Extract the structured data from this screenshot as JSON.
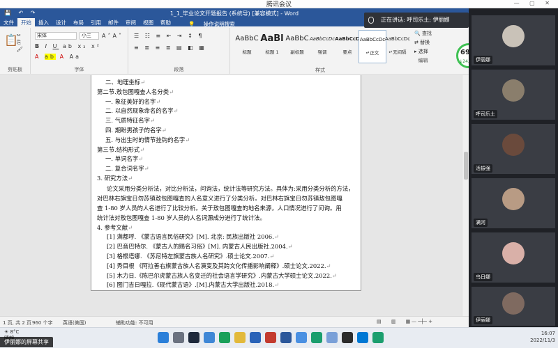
{
  "meeting": {
    "title": "腾讯会议",
    "speaking_label": "正在讲话: 呼司乐土; 伊丽娜"
  },
  "stat": {
    "percent": "69%",
    "sub": "↓24.3K/s"
  },
  "word": {
    "window_title": "1_1_毕业论文开题报告 (系统导) [兼容模式] - Word",
    "tabs": [
      "文件",
      "开始",
      "插入",
      "设计",
      "布局",
      "引用",
      "邮件",
      "审阅",
      "视图",
      "帮助"
    ],
    "tell_me": "操作说明搜索",
    "font_name": "宋体",
    "font_size": "小三",
    "groups": {
      "clipboard": "剪贴板",
      "font": "字体",
      "paragraph": "段落",
      "styles": "样式",
      "editing": "编辑"
    },
    "styles": [
      {
        "sample": "AaBbC",
        "name": "标题"
      },
      {
        "sample": "AaBl",
        "name": "标题 1"
      },
      {
        "sample": "AaBbC",
        "name": "副标题"
      },
      {
        "sample": "AaBbCcDc",
        "name": "强调"
      },
      {
        "sample": "AaBbCcD",
        "name": "要点"
      },
      {
        "sample": "AaBbCcDc",
        "name": "↵正文"
      },
      {
        "sample": "AaBbCcDc",
        "name": "↵无间隔"
      }
    ],
    "editing": [
      "查找",
      "替换",
      "选择"
    ],
    "status": {
      "page": "1 页, 共 2 页",
      "words": "960 个字",
      "lang": "英语(美国)",
      "accessibility": "辅助功能: 不可用"
    }
  },
  "document": {
    "lines": [
      {
        "text": "二、地理坐标",
        "indent": 1
      },
      {
        "text": "第二节.敖包图嘎查人名分类",
        "indent": 0
      },
      {
        "text": "一. 象征美好的名字",
        "indent": 1
      },
      {
        "text": "二. 以自然现象命名的名字",
        "indent": 1
      },
      {
        "text": "三. 气质特征名字",
        "indent": 1
      },
      {
        "text": "四. 期盼男孩子的名字",
        "indent": 1
      },
      {
        "text": "五. 与出生时的情节挂钩的名字",
        "indent": 1
      },
      {
        "text": "第三节.结构形式",
        "indent": 0
      },
      {
        "text": "一. 单词名字",
        "indent": 1
      },
      {
        "text": "二. 复合词名字",
        "indent": 1
      },
      {
        "text": "3.   研究方法",
        "indent": 0
      }
    ],
    "method_para": [
      "论文采用分类分析法，对比分析法，问询法，统计法等研究方法。具体为:采用分类分析的方法，",
      "对巴林右旗宝日勿苏镇敖包图嘎查的人名意义进行了分类分析。对巴林右旗宝日勿苏镇敖包图嘎",
      "查 1-80 岁人员的人名进行了比较分析。关于敖包图嘎查的地名来源，人口情况进行了问询。用",
      "统计法对敖包图嘎查 1-80 岁人员的人名词源成分进行了统计法。"
    ],
    "refs_heading": "4.   参考文献",
    "refs": [
      "[1] 满都呼. 《蒙古语言民俗研究》[M]. 北京: 民族出版社 2006.",
      "[2] 巴音巴特尔. 《蒙古人的赐名习俗》[M]. 内蒙古人民出版社.2004.",
      "[3] 格根塔娜. 《苏尼特左旗蒙古族人名研究》.硕士论文.2007.",
      "[4] 秀目根 《阿拉善右旗蒙古族人名演变及其跨文化传播影响阐释》.硕士论文.2022.",
      "[5] 木力日.《陈巴尔虎蒙古族人名变迁的社会语言学研究》.内蒙古大学硕士论文.2022.",
      "[6] 图门吉日嘎拉.《现代蒙古语》.[M].内蒙古大学出版社.2018."
    ]
  },
  "participants": [
    {
      "name": "伊丽娜",
      "color": "#c9c2b8"
    },
    {
      "name": "呼司乐土",
      "color": "#8a7e6c"
    },
    {
      "name": "活振强",
      "color": "#2b2e35"
    },
    {
      "name": "满河",
      "color": "#9aa3a8"
    },
    {
      "name": "乌日娜",
      "color": "#2b2e35"
    },
    {
      "name": "伊丽娜",
      "color": "#bfc3c8"
    }
  ],
  "taskbar": {
    "weather_temp": "8°C",
    "weather_desc": "晴朗",
    "time": "16:07",
    "date": "2022/11/3",
    "share_label": "伊丽娜的屏幕共享"
  }
}
